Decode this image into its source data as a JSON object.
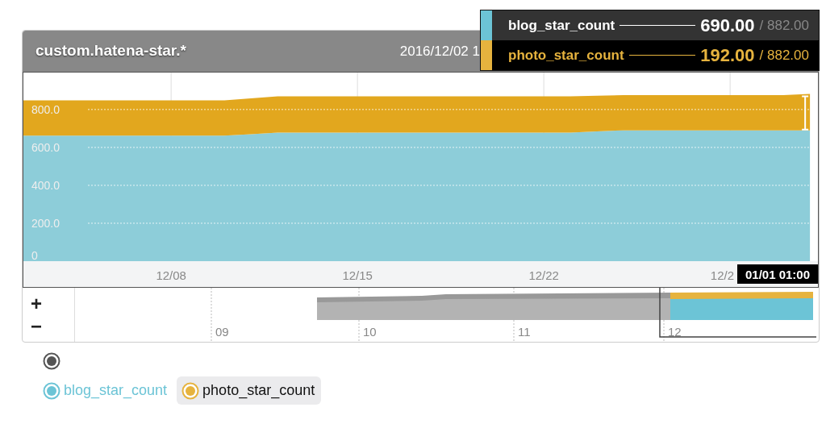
{
  "header": {
    "title": "custom.hatena-star.*",
    "time": "2016/12/02 1"
  },
  "tooltip": {
    "rows": [
      {
        "name": "blog_star_count",
        "value": "690.00",
        "total": "/ 882.00",
        "color": "#6cc4d6",
        "selected": false
      },
      {
        "name": "photo_star_count",
        "value": "192.00",
        "total": "/ 882.00",
        "color": "#e6b33e",
        "selected": true
      }
    ]
  },
  "chart": {
    "crosshair_label": "01/01 01:00",
    "chart_data": {
      "type": "area",
      "stacked": true,
      "categories": [
        null,
        null,
        null,
        null,
        null,
        null,
        "12/08",
        null,
        null,
        null,
        null,
        null,
        null,
        "12/15",
        null,
        null,
        null,
        null,
        null,
        null,
        "12/22",
        null,
        null,
        null,
        null,
        null,
        null,
        "12/2",
        null,
        null,
        null
      ],
      "series": [
        {
          "name": "blog_star_count",
          "color": "#8dcdd9",
          "values": [
            662,
            662,
            662,
            662,
            662,
            662,
            662,
            662,
            662,
            670,
            678,
            678,
            678,
            678,
            678,
            678,
            678,
            678,
            678,
            678,
            678,
            678,
            685,
            690,
            690,
            690,
            690,
            690,
            690,
            690,
            690
          ]
        },
        {
          "name": "photo_star_count",
          "color": "#e2a71e",
          "values": [
            186,
            186,
            186,
            186,
            186,
            186,
            186,
            186,
            186,
            189,
            191,
            191,
            191,
            191,
            191,
            191,
            191,
            191,
            191,
            191,
            191,
            191,
            188,
            186,
            186,
            186,
            186,
            186,
            186,
            186,
            192
          ]
        }
      ],
      "grid": true,
      "ylim": [
        0,
        995
      ],
      "yticks": [
        {
          "value": 0,
          "label": "0"
        },
        {
          "value": 200,
          "label": "200.0"
        },
        {
          "value": 400,
          "label": "400.0"
        },
        {
          "value": 600,
          "label": "600.0"
        },
        {
          "value": 800,
          "label": "800.0"
        }
      ]
    }
  },
  "navigator": {
    "zoom_buttons": [
      "+",
      "−"
    ],
    "months": [
      "09",
      "10",
      "11",
      "12"
    ]
  },
  "legend": {
    "toggle_all": {
      "checked": true
    },
    "items": [
      {
        "color": "#6cc4d6",
        "selected": false
      },
      {
        "color": "#e6b33e",
        "selected": true
      }
    ]
  }
}
